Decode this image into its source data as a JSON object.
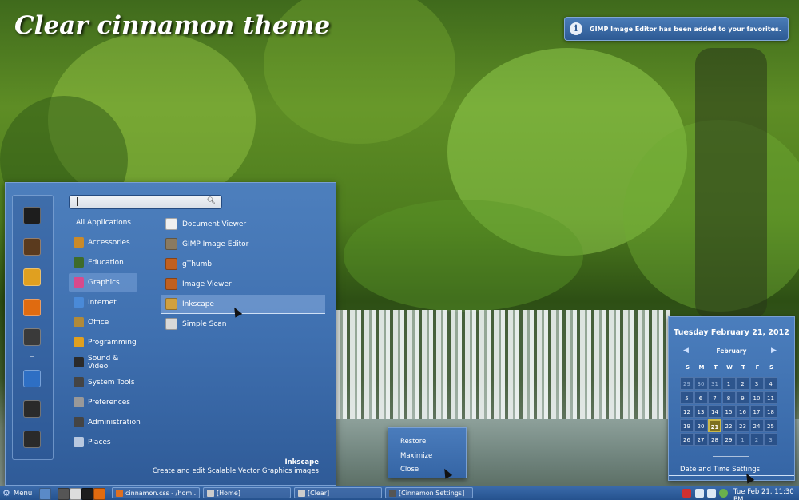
{
  "desktop": {
    "title": "Clear cinnamon theme"
  },
  "notification": {
    "text": "GIMP Image Editor has been added to your favorites.",
    "icon": "info-icon"
  },
  "menu": {
    "search": {
      "value": "",
      "placeholder": ""
    },
    "favorites": [
      {
        "name": "terminal-icon",
        "color": "#1d1d1d"
      },
      {
        "name": "system-monitor-icon",
        "color": "#5a3a1e"
      },
      {
        "name": "users-icon",
        "color": "#e0a020"
      },
      {
        "name": "firefox-icon",
        "color": "#e06b10"
      },
      {
        "name": "settings-icon",
        "color": "#3a3a3a"
      },
      {
        "name": "computer-icon",
        "color": "#2e6fc4"
      },
      {
        "name": "logout-icon",
        "color": "#2a2a2a"
      },
      {
        "name": "power-icon",
        "color": "#2a2a2a"
      }
    ],
    "categories": [
      {
        "label": "All Applications",
        "icon": "",
        "color": ""
      },
      {
        "label": "Accessories",
        "icon": "accessories-icon",
        "color": "#c98a2a"
      },
      {
        "label": "Education",
        "icon": "education-icon",
        "color": "#3e6b2a"
      },
      {
        "label": "Graphics",
        "icon": "graphics-icon",
        "color": "#d84a8c"
      },
      {
        "label": "Internet",
        "icon": "internet-icon",
        "color": "#4a8ad8"
      },
      {
        "label": "Office",
        "icon": "office-icon",
        "color": "#b08a3a"
      },
      {
        "label": "Programming",
        "icon": "programming-icon",
        "color": "#e0a020"
      },
      {
        "label": "Sound & Video",
        "icon": "sound-video-icon",
        "color": "#2a2a2a"
      },
      {
        "label": "System Tools",
        "icon": "system-tools-icon",
        "color": "#444444"
      },
      {
        "label": "Preferences",
        "icon": "preferences-icon",
        "color": "#999999"
      },
      {
        "label": "Administration",
        "icon": "administration-icon",
        "color": "#444444"
      },
      {
        "label": "Places",
        "icon": "places-icon",
        "color": "#b8c8e0"
      }
    ],
    "selected_category": "Graphics",
    "apps": [
      {
        "label": "Document Viewer",
        "icon": "document-viewer-icon",
        "color": "#f0f0f0"
      },
      {
        "label": "GIMP Image Editor",
        "icon": "gimp-icon",
        "color": "#8a7a60"
      },
      {
        "label": "gThumb",
        "icon": "gthumb-icon",
        "color": "#c06020"
      },
      {
        "label": "Image Viewer",
        "icon": "image-viewer-icon",
        "color": "#c06020"
      },
      {
        "label": "Inkscape",
        "icon": "inkscape-icon",
        "color": "#d0a040"
      },
      {
        "label": "Simple Scan",
        "icon": "simple-scan-icon",
        "color": "#d8d8d8"
      }
    ],
    "hovered_app": "Inkscape",
    "description": {
      "title": "Inkscape",
      "text": "Create and edit Scalable Vector Graphics images"
    }
  },
  "context_menu": {
    "items": [
      "Restore",
      "Maximize",
      "Close"
    ],
    "hovered": "Close"
  },
  "calendar": {
    "date_title": "Tuesday February 21, 2012",
    "month": "February",
    "weekdays": [
      "S",
      "M",
      "T",
      "W",
      "T",
      "F",
      "S"
    ],
    "weeks": [
      [
        "29",
        "30",
        "31",
        "1",
        "2",
        "3",
        "4"
      ],
      [
        "5",
        "6",
        "7",
        "8",
        "9",
        "10",
        "11"
      ],
      [
        "12",
        "13",
        "14",
        "15",
        "16",
        "17",
        "18"
      ],
      [
        "19",
        "20",
        "21",
        "22",
        "23",
        "24",
        "25"
      ],
      [
        "26",
        "27",
        "28",
        "29",
        "1",
        "2",
        "3"
      ]
    ],
    "today": "21",
    "settings_label": "Date and Time Settings"
  },
  "panel": {
    "menu_label": "Menu",
    "launchers": [
      {
        "name": "show-desktop-icon",
        "color": "#5a8ac8"
      },
      {
        "name": "settings-launcher-icon",
        "color": "#555555"
      },
      {
        "name": "files-launcher-icon",
        "color": "#dddddd"
      },
      {
        "name": "terminal-launcher-icon",
        "color": "#1d1d1d"
      },
      {
        "name": "firefox-launcher-icon",
        "color": "#e06b10"
      },
      {
        "name": "gimp-launcher-icon",
        "color": "#8a7a60"
      }
    ],
    "windows": [
      {
        "label": "cinnamon.css - /hom...",
        "color": "#e07020"
      },
      {
        "label": "[Home]",
        "color": "#cccccc"
      },
      {
        "label": "[Clear]",
        "color": "#cccccc"
      },
      {
        "label": "[Cinnamon Settings]",
        "color": "#555555"
      }
    ],
    "tray": [
      {
        "name": "update-icon",
        "color": "#d03030"
      },
      {
        "name": "network-icon",
        "color": "#dde8f5"
      },
      {
        "name": "volume-icon",
        "color": "#dde8f5"
      },
      {
        "name": "power-tray-icon",
        "color": "#ffffff"
      },
      {
        "name": "updates-ok-icon",
        "color": "#6ab04c"
      }
    ],
    "clock": "Tue Feb 21, 11:30 PM"
  }
}
